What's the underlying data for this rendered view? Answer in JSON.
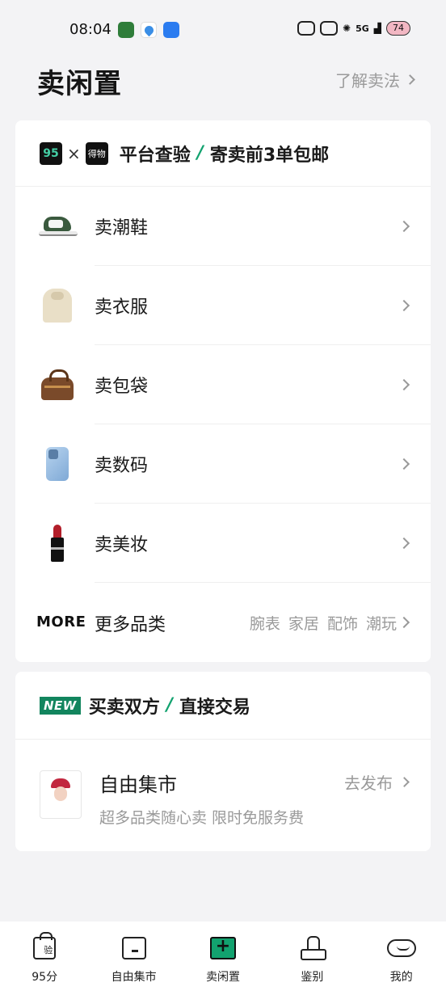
{
  "status_bar": {
    "time": "08:04",
    "network": "5G",
    "battery": "74"
  },
  "header": {
    "title": "卖闲置",
    "learn_link": "了解卖法"
  },
  "sell_card": {
    "logo_left": "95",
    "logo_right": "得物",
    "banner_part1": "平台查验",
    "banner_slash": "/",
    "banner_part2": "寄卖前3单包邮",
    "categories": [
      {
        "label": "卖潮鞋",
        "icon": "sneaker-icon"
      },
      {
        "label": "卖衣服",
        "icon": "hoodie-icon"
      },
      {
        "label": "卖包袋",
        "icon": "handbag-icon"
      },
      {
        "label": "卖数码",
        "icon": "phone-icon"
      },
      {
        "label": "卖美妆",
        "icon": "lipstick-icon"
      }
    ],
    "more": {
      "tag": "MORE",
      "label": "更多品类",
      "sub": "腕表 家居 配饰 潮玩"
    }
  },
  "market_card": {
    "new_tag": "NEW",
    "banner_part1": "买卖双方",
    "banner_slash": "/",
    "banner_part2": "直接交易",
    "title": "自由集市",
    "subtitle": "超多品类随心卖 限时免服务费",
    "action": "去发布"
  },
  "tab_bar": {
    "tabs": [
      {
        "label": "95分",
        "icon": "shopping-bag-icon",
        "bag_text": "验"
      },
      {
        "label": "自由集市",
        "icon": "market-icon"
      },
      {
        "label": "卖闲置",
        "icon": "sell-plus-icon",
        "active": true
      },
      {
        "label": "鉴别",
        "icon": "stamp-icon"
      },
      {
        "label": "我的",
        "icon": "profile-icon"
      }
    ]
  },
  "colors": {
    "accent": "#12a26f",
    "new_tag": "#12855e",
    "background": "#f3f3f5",
    "muted_text": "#9a9a9a"
  }
}
